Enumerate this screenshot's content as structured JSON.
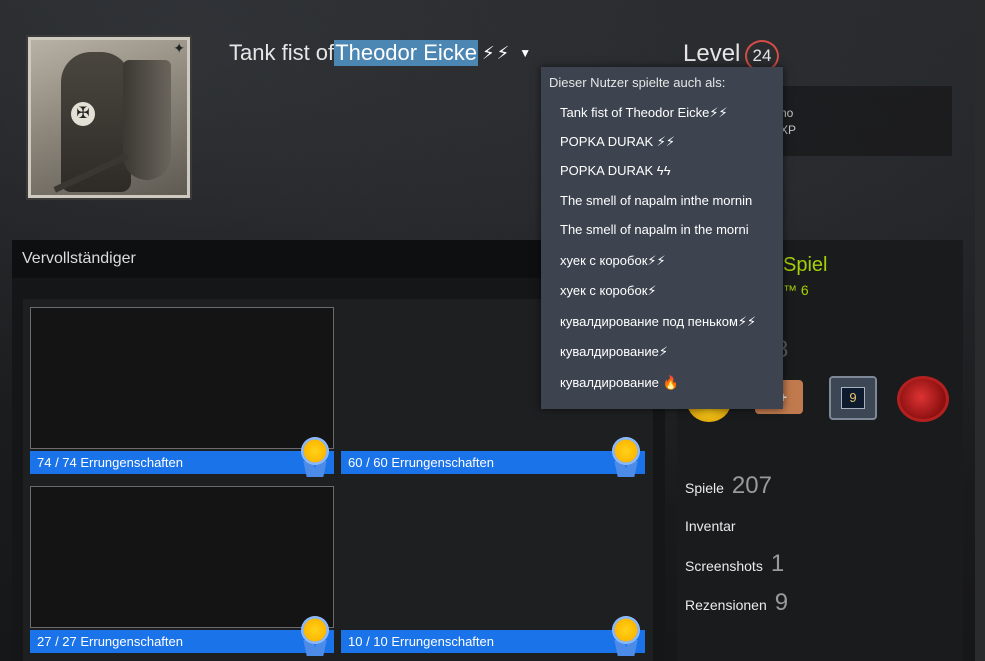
{
  "header": {
    "persona_prefix": "Tank fist of ",
    "persona_selected": "Theodor Eicke",
    "persona_bolts": "⚡⚡",
    "level_label": "Level",
    "level_value": "24",
    "xp_line1": "no",
    "xp_line2": "XP"
  },
  "alias_dropdown": {
    "title": "Dieser Nutzer spielte auch als:",
    "items": [
      "Tank fist of Theodor Eicke⚡⚡",
      "POPKA DURAK ⚡⚡",
      "POPKA DURAK ϟϟ",
      "The smell of napalm inthe mornin",
      "The smell of napalm in the morni",
      "хуек с коробок⚡⚡",
      "хуек с коробок⚡",
      "кувалдирование под пеньком⚡⚡",
      "кувалдирование⚡",
      "кувалдирование "
    ],
    "last_item_icon": "🔥"
  },
  "showcase": {
    "title": "Vervollständiger",
    "tiles": [
      {
        "label": "74 / 74 Errungenschaften"
      },
      {
        "label": "60 / 60 Errungenschaften"
      },
      {
        "label": "27 / 27 Errungenschaften"
      },
      {
        "label": "10 / 10 Errungenschaften"
      }
    ]
  },
  "rightcol": {
    "game_text": "Spiel",
    "game_sub": "™ 6",
    "faded_num": "8",
    "badge_b2_text": "0+",
    "badge_b3_text": "9",
    "stats": [
      {
        "label": "Spiele",
        "value": "207"
      },
      {
        "label": "Inventar",
        "value": ""
      },
      {
        "label": "Screenshots",
        "value": "1"
      },
      {
        "label": "Rezensionen",
        "value": "9"
      }
    ]
  },
  "colors": {
    "accent_blue": "#1a73e8",
    "level_ring": "#d24d45",
    "game_green": "#a4d007",
    "dropdown_bg": "#3d4450"
  }
}
